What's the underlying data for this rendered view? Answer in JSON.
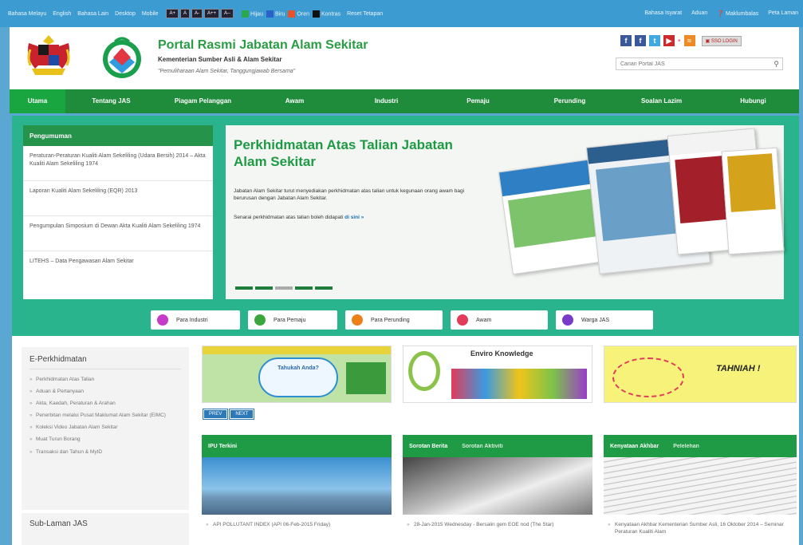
{
  "util": {
    "lang": [
      "Bahasa Melayu",
      "English",
      "Bahasa Lain",
      "Desktop",
      "Mobile"
    ],
    "font_buttons": [
      "A+",
      "A",
      "A-",
      "A++",
      "A--"
    ],
    "colors": [
      {
        "label": "Hijau",
        "color": "#2aa84a"
      },
      {
        "label": "Biru",
        "color": "#2a62c8"
      },
      {
        "label": "Oren",
        "color": "#e6522c"
      },
      {
        "label": "Kontras",
        "color": "#111111"
      }
    ],
    "reset": "Reset Tetapan",
    "right": [
      "Bahasa Isyarat",
      "Aduan",
      "Maklumbalas",
      "Peta Laman"
    ]
  },
  "header": {
    "title": "Portal Rasmi Jabatan Alam Sekitar",
    "ministry": "Kementerian Sumber Asli & Alam Sekitar",
    "motto": "\"Pemuliharaan Alam Sekitar, Tanggungjawab Bersama\"",
    "sso": "SSO LOGIN",
    "search_placeholder": "Carian Portal JAS"
  },
  "nav": [
    "Utama",
    "Tentang JAS",
    "Piagam Pelanggan",
    "Awam",
    "Industri",
    "Pemaju",
    "Perunding",
    "Soalan Lazim",
    "Hubungi"
  ],
  "announce": {
    "title": "Pengumuman",
    "items": [
      "Peraturan-Peraturan Kualiti Alam Sekeliling (Udara Bersih) 2014 – Akta Kualiti Alam Sekeliling 1974",
      "Laporan Kualiti Alam Sekeliling (EQR) 2013",
      "Pengumpulan Simposium di Dewan Akta Kualiti Alam Sekeliling 1974",
      "LITEHS – Data Pengawasan Alam Sekitar"
    ]
  },
  "banner": {
    "title": "Perkhidmatan Atas Talian Jabatan Alam Sekitar",
    "desc": "Jabatan Alam Sekitar turut menyediakan perkhidmatan atas talian untuk kegunaan orang awam bagi berurusan dengan Jabatan Alam Sekitar.",
    "more_prefix": "Senarai perkhidmatan atas talian boleh didapati",
    "more_link": "di sini »"
  },
  "audience": [
    {
      "label": "Para Industri",
      "color": "#c53cc9"
    },
    {
      "label": "Para Pemaju",
      "color": "#3aa63c"
    },
    {
      "label": "Para Perunding",
      "color": "#ef7f1a"
    },
    {
      "label": "Awam",
      "color": "#e23c5a"
    },
    {
      "label": "Warga JAS",
      "color": "#7a3cc8"
    }
  ],
  "eperk": {
    "title": "E-Perkhidmatan",
    "items": [
      "Perkhidmatan Atas Talian",
      "Aduan & Pertanyaan",
      "Akta, Kaedah, Peraturan & Arahan",
      "Penerbitan melalui Pusat Maklumat Alam Sekitar (EIMC)",
      "Koleksi Video Jabatan Alam Sekitar",
      "Muat Turun Borang",
      "Transaksi dan Tahun & MyID"
    ]
  },
  "sublaman": {
    "title": "Sub-Laman JAS"
  },
  "prevnext": [
    "PREV",
    "NEXT"
  ],
  "ads": [
    "Tahukah Anda?",
    "Enviro Knowledge",
    "TAHNIAH !"
  ],
  "panels": [
    {
      "tab1": "IPU Terkini",
      "tab2": "",
      "text": "API POLLUTANT INDEX (API 06-Feb-2015 Friday)"
    },
    {
      "tab1": "Sorotan Berita",
      "tab2": "Sorotan Aktiviti",
      "text": "28-Jan-2015 Wednesday - Bersalin gem EOE nod (The Star)"
    },
    {
      "tab1": "Kenyataan Akhbar",
      "tab2": "Pelelehan",
      "text": "Kenyataan Akhbar Kementerian Sumber Asli, 16 Oktober 2014 – Seminar Peraturan Kualiti Alam"
    }
  ]
}
